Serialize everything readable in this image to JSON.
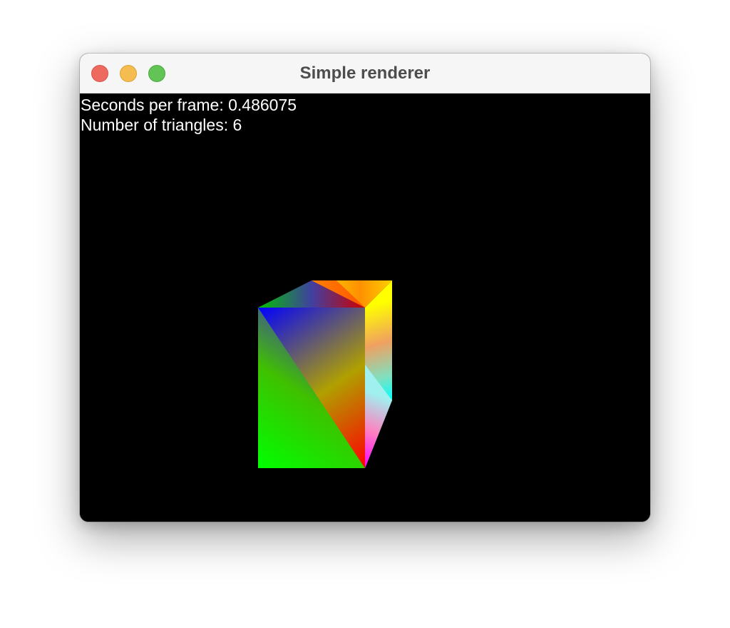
{
  "window": {
    "title": "Simple renderer"
  },
  "overlay": {
    "seconds_per_frame_label": "Seconds per frame:",
    "seconds_per_frame_value": "0.486075",
    "triangles_label": "Number of triangles:",
    "triangles_value": "6"
  },
  "colors": {
    "background": "#000000",
    "text": "#ffffff",
    "close": "#ee6a5f",
    "minimize": "#f5bd4f",
    "zoom": "#61c454"
  }
}
